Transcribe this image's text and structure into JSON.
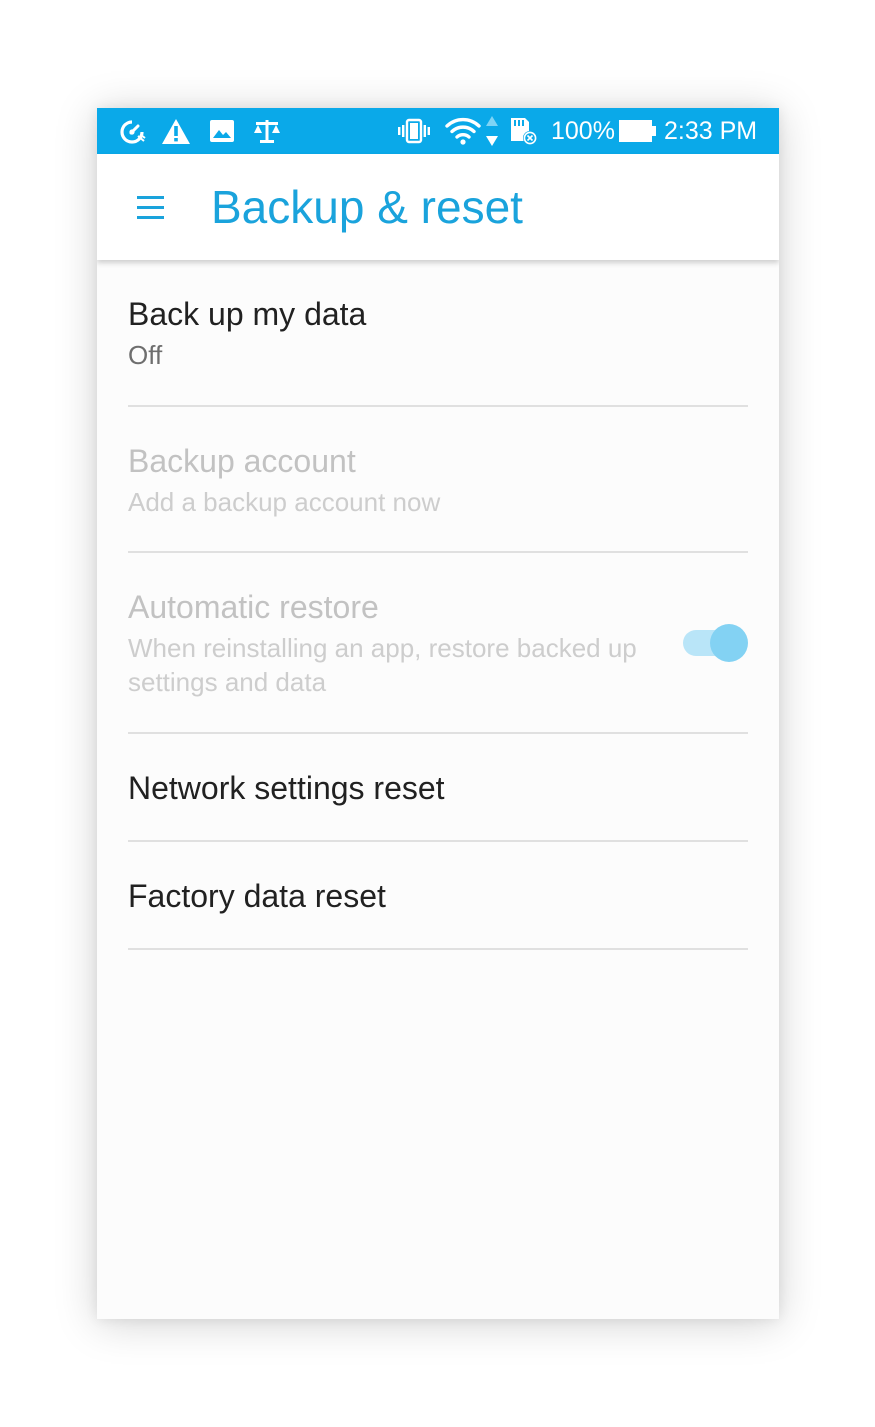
{
  "status_bar": {
    "icons_left": [
      "speedometer-icon",
      "warning-icon",
      "image-icon",
      "scale-icon"
    ],
    "icons_right": [
      "vibrate-icon",
      "wifi-icon",
      "data-arrows-icon",
      "sd-card-error-icon",
      "battery-icon"
    ],
    "battery": "100%",
    "time": "2:33 PM",
    "background_color": "#0aa9e9"
  },
  "app_bar": {
    "menu_icon": "hamburger-menu-icon",
    "title": "Backup & reset",
    "accent_color": "#1aa3dc"
  },
  "settings": [
    {
      "title": "Back up my data",
      "subtitle": "Off",
      "enabled": true
    },
    {
      "title": "Backup account",
      "subtitle": "Add a backup account now",
      "enabled": false
    },
    {
      "title": "Automatic restore",
      "subtitle": "When reinstalling an app, restore backed up settings and data",
      "enabled": false,
      "toggle": "on"
    },
    {
      "title": "Network settings reset",
      "enabled": true
    },
    {
      "title": "Factory data reset",
      "enabled": true
    }
  ]
}
